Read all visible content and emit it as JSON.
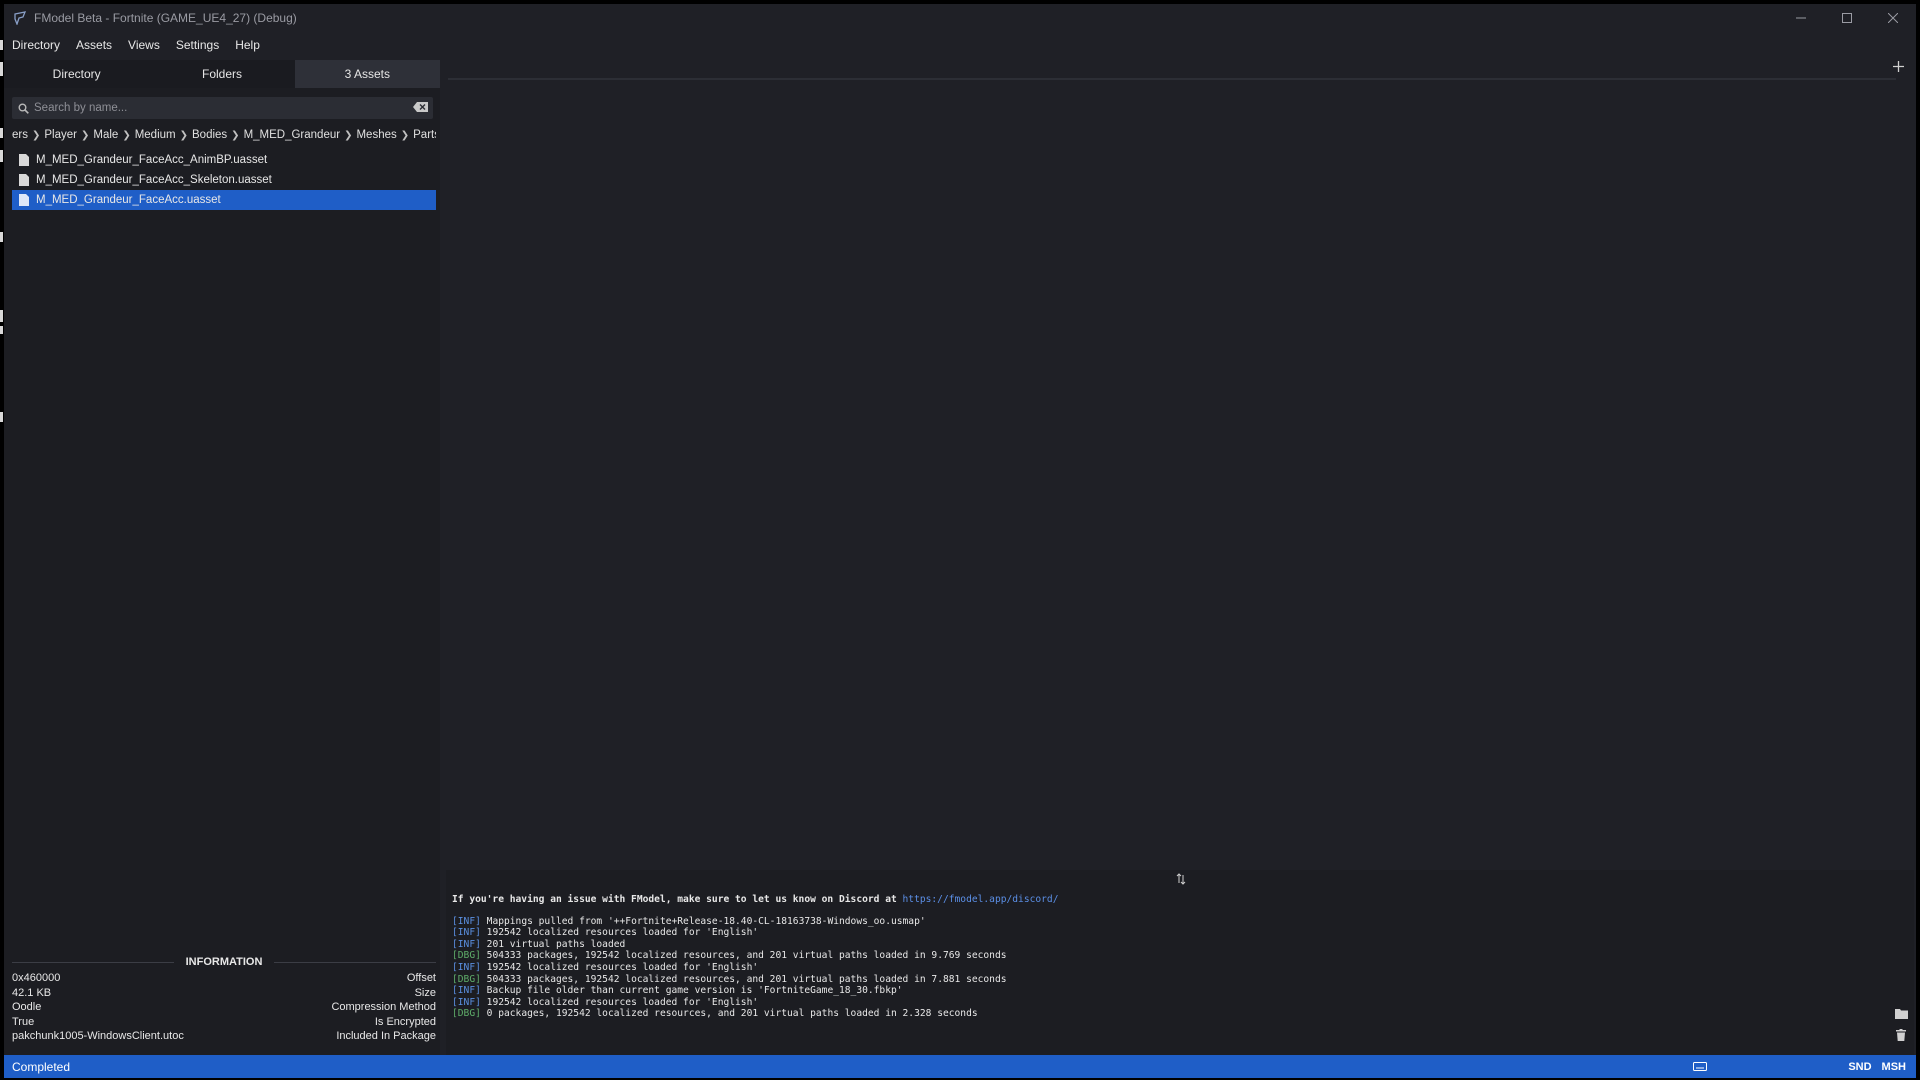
{
  "window": {
    "title": "FModel Beta - Fortnite (GAME_UE4_27) (Debug)",
    "min_icon": "minimize-icon",
    "max_icon": "maximize-icon",
    "close_icon": "close-icon"
  },
  "menu": {
    "items": [
      "Directory",
      "Assets",
      "Views",
      "Settings",
      "Help"
    ]
  },
  "left": {
    "tabs": [
      {
        "label": "Directory"
      },
      {
        "label": "Folders"
      },
      {
        "label": "3 Assets"
      }
    ],
    "search": {
      "placeholder": "Search by name...",
      "value": ""
    },
    "breadcrumb": [
      "ers",
      "Player",
      "Male",
      "Medium",
      "Bodies",
      "M_MED_Grandeur",
      "Meshes",
      "Parts"
    ],
    "files": [
      {
        "name": "M_MED_Grandeur_FaceAcc_AnimBP.uasset",
        "selected": false
      },
      {
        "name": "M_MED_Grandeur_FaceAcc_Skeleton.uasset",
        "selected": false
      },
      {
        "name": "M_MED_Grandeur_FaceAcc.uasset",
        "selected": true
      }
    ],
    "info": {
      "title": "INFORMATION",
      "rows": [
        {
          "value": "0x460000",
          "key": "Offset"
        },
        {
          "value": "42.1 KB",
          "key": "Size"
        },
        {
          "value": "Oodle",
          "key": "Compression Method"
        },
        {
          "value": "True",
          "key": "Is Encrypted"
        },
        {
          "value": "pakchunk1005-WindowsClient.utoc",
          "key": "Included In Package"
        }
      ]
    }
  },
  "console": {
    "header": "If you're having an issue with FModel, make sure to let us know on Discord at ",
    "link": "https://fmodel.app/discord/",
    "lines": [
      {
        "level": "[INF]",
        "text": " Mappings pulled from '++Fortnite+Release-18.40-CL-18163738-Windows_oo.usmap'"
      },
      {
        "level": "[INF]",
        "text": " 192542 localized resources loaded for 'English'"
      },
      {
        "level": "[INF]",
        "text": " 201 virtual paths loaded"
      },
      {
        "level": "[DBG]",
        "text": " 504333 packages, 192542 localized resources, and 201 virtual paths loaded in 9.769 seconds"
      },
      {
        "level": "[INF]",
        "text": " 192542 localized resources loaded for 'English'"
      },
      {
        "level": "[DBG]",
        "text": " 504333 packages, 192542 localized resources, and 201 virtual paths loaded in 7.881 seconds"
      },
      {
        "level": "[INF]",
        "text": " Backup file older than current game version is 'FortniteGame_18_30.fbkp'"
      },
      {
        "level": "[INF]",
        "text": " 192542 localized resources loaded for 'English'"
      },
      {
        "level": "[DBG]",
        "text": " 0 packages, 192542 localized resources, and 201 virtual paths loaded in 2.328 seconds"
      }
    ]
  },
  "status": {
    "text": "Completed",
    "indicators": [
      "SND",
      "MSH"
    ]
  },
  "colors": {
    "accent": "#1f5ec7",
    "background": "#1f2026",
    "info_level": "#5a8fe0",
    "debug_level": "#5fae6a",
    "link": "#5b8fe6"
  }
}
